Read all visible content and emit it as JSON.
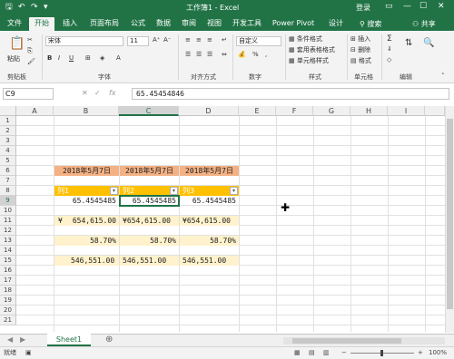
{
  "titlebar": {
    "title": "工作簿1 - Excel",
    "login": "登录",
    "save_icon": "save-icon",
    "undo_icon": "undo-icon",
    "redo_icon": "redo-icon"
  },
  "tabs": {
    "items": [
      "文件",
      "开始",
      "插入",
      "页面布局",
      "公式",
      "数据",
      "审阅",
      "视图",
      "开发工具",
      "Power Pivot",
      "设计"
    ],
    "search": "搜索",
    "share": "共享"
  },
  "ribbon": {
    "font_name": "宋体",
    "font_size": "11",
    "number_format": "自定义",
    "cond_format": "条件格式",
    "table_format": "套用表格格式",
    "cell_style": "单元格样式",
    "insert": "插入",
    "delete": "删除",
    "format": "格式",
    "groups": [
      "剪贴板",
      "字体",
      "对齐方式",
      "数字",
      "样式",
      "单元格",
      "编辑"
    ],
    "bold": "B",
    "italic": "I",
    "underline": "U",
    "percent": "%",
    "comma": ","
  },
  "formula_bar": {
    "cell_ref": "C9",
    "value": "65.45454846"
  },
  "columns": [
    "A",
    "B",
    "C",
    "D",
    "E",
    "F",
    "G",
    "H",
    "I"
  ],
  "rows": [
    "1",
    "2",
    "3",
    "4",
    "5",
    "6",
    "7",
    "8",
    "9",
    "10",
    "11",
    "12",
    "13",
    "14",
    "15",
    "16",
    "17",
    "18",
    "19",
    "20",
    "21"
  ],
  "cells": {
    "date_b6": "2018年5月7日",
    "date_c6": "2018年5月7日",
    "date_d6": "2018年5月7日",
    "hdr_b8": "列1",
    "hdr_c8": "列2",
    "hdr_d8": "列3",
    "b9": "65.4545485",
    "c9": "65.4545485",
    "d9": "65.4545485",
    "b11_sym": "¥",
    "b11": "654,615.00",
    "c11": "¥654,615.00",
    "d11": "¥654,615.00",
    "b13": "58.70%",
    "c13": "58.70%",
    "d13": "58.70%",
    "b15": "546,551.00",
    "c15": "546,551.00",
    "d15": "546,551.00"
  },
  "sheet": {
    "tab": "Sheet1"
  },
  "status": {
    "mode": "就绪",
    "zoom": "100%"
  },
  "colors": {
    "accent": "#217346",
    "header_fill": "#ffc000",
    "date_fill": "#f4b183",
    "stripe_fill": "#fff2cc"
  }
}
